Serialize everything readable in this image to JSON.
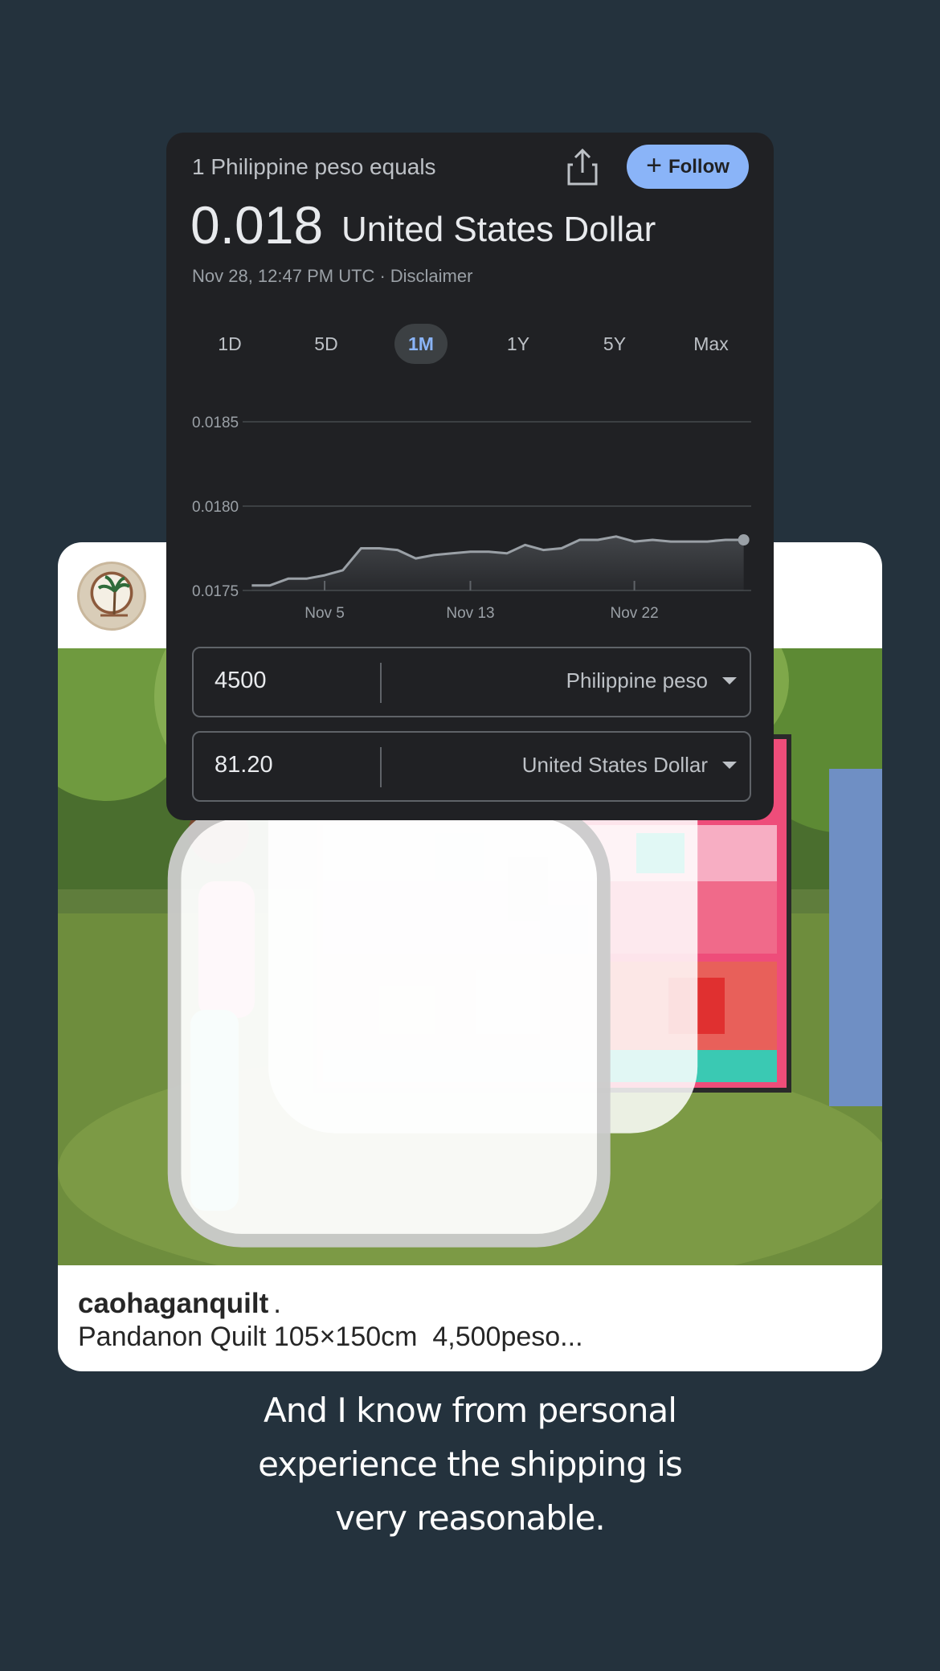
{
  "post": {
    "username": "caohaganquilt",
    "username_suffix": ".",
    "caption": "Pandanon Quilt 105×150cm  4,500peso..."
  },
  "widget": {
    "subtitle": "1 Philippine peso equals",
    "value": "0.018",
    "currency": "United States Dollar",
    "timestamp": "Nov 28, 12:47 PM UTC",
    "separator": "·",
    "disclaimer": "Disclaimer",
    "follow_label": "Follow",
    "tabs": [
      {
        "label": "1D",
        "active": false
      },
      {
        "label": "5D",
        "active": false
      },
      {
        "label": "1M",
        "active": true
      },
      {
        "label": "1Y",
        "active": false
      },
      {
        "label": "5Y",
        "active": false
      },
      {
        "label": "Max",
        "active": false
      }
    ],
    "converter": {
      "from_amount": "4500",
      "from_currency": "Philippine peso",
      "to_amount": "81.20",
      "to_currency": "United States Dollar"
    },
    "colors": {
      "accent": "#8ab4f8",
      "background": "#202124",
      "line": "#9aa0a6"
    }
  },
  "chart_data": {
    "type": "area",
    "title": "",
    "xlabel": "",
    "ylabel": "",
    "y_ticks": [
      "0.0185",
      "0.0180",
      "0.0175"
    ],
    "y_tick_values": [
      0.0185,
      0.018,
      0.0175
    ],
    "x_ticks": [
      "Nov 5",
      "Nov 13",
      "Nov 22"
    ],
    "x_tick_values": [
      5,
      13,
      22
    ],
    "ylim": [
      0.0175,
      0.0185
    ],
    "xlim": [
      0.5,
      28.5
    ],
    "grid": true,
    "series": [
      {
        "x": [
          1,
          2,
          3,
          4,
          5,
          6,
          7,
          8,
          9,
          10,
          11,
          12,
          13,
          14,
          15,
          16,
          17,
          18,
          19,
          20,
          21,
          22,
          23,
          24,
          25,
          26,
          27,
          28
        ],
        "values": [
          0.01753,
          0.01753,
          0.01757,
          0.01757,
          0.01759,
          0.01762,
          0.01775,
          0.01775,
          0.01774,
          0.01769,
          0.01771,
          0.01772,
          0.01773,
          0.01773,
          0.01772,
          0.01777,
          0.01774,
          0.01775,
          0.0178,
          0.0178,
          0.01782,
          0.01779,
          0.0178,
          0.01779,
          0.01779,
          0.01779,
          0.0178,
          0.0178
        ]
      }
    ]
  },
  "story": {
    "line1": "And I know from personal",
    "line2": "experience the shipping is",
    "line3": "very reasonable."
  }
}
